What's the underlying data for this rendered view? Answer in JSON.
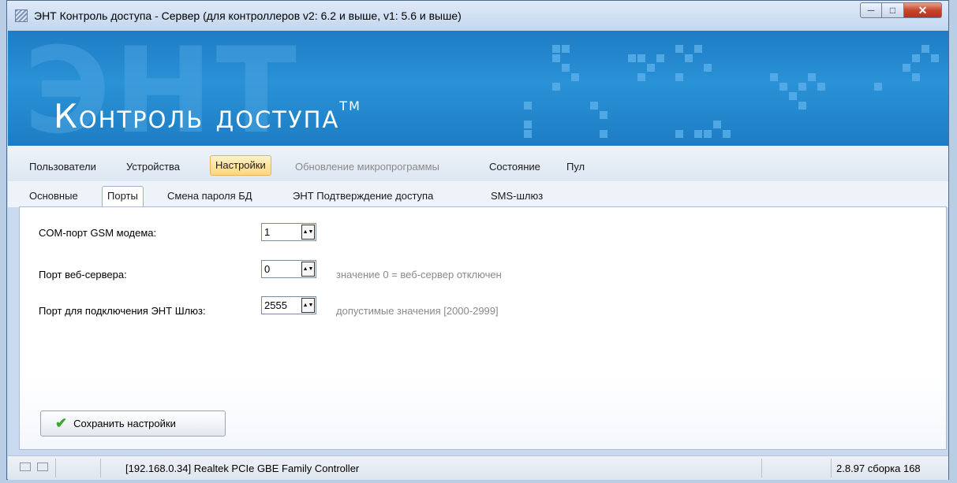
{
  "window": {
    "title": "ЭНТ Контроль доступа - Сервер (для контроллеров v2: 6.2  и выше, v1: 5.6 и выше)"
  },
  "banner": {
    "watermark": "ЭНТ",
    "logo": "Контроль доступа",
    "trademark": "TM"
  },
  "main_tabs": [
    {
      "label": "Пользователи"
    },
    {
      "label": "Устройства"
    },
    {
      "label": "Настройки",
      "active": true
    },
    {
      "label": "Обновление микропрограммы",
      "disabled": true
    },
    {
      "label": "Состояние"
    },
    {
      "label": "Пул"
    }
  ],
  "sub_tabs": [
    {
      "label": "Основные"
    },
    {
      "label": "Порты",
      "active": true
    },
    {
      "label": "Смена пароля БД"
    },
    {
      "label": "ЭНТ Подтверждение доступа"
    },
    {
      "label": "SMS-шлюз"
    }
  ],
  "fields": {
    "gsm_com_port": {
      "label": "COM-порт GSM модема:",
      "value": "1"
    },
    "web_server_port": {
      "label": "Порт веб-сервера:",
      "value": "0",
      "hint": "значение 0 = веб-сервер отключен"
    },
    "gateway_port": {
      "label": "Порт для подключения ЭНТ Шлюз:",
      "value": "2555",
      "hint": "допустимые значения [2000-2999]"
    }
  },
  "save_button": {
    "label": "Сохранить настройки",
    "icon": "check-icon"
  },
  "statusbar": {
    "connection": "[192.168.0.34] Realtek PCIe GBE Family Controller",
    "version": "2.8.97 сборка 168"
  },
  "colors": {
    "banner": "#2a92d6",
    "active_tab": "#ffd77a",
    "check": "#3fa433"
  }
}
